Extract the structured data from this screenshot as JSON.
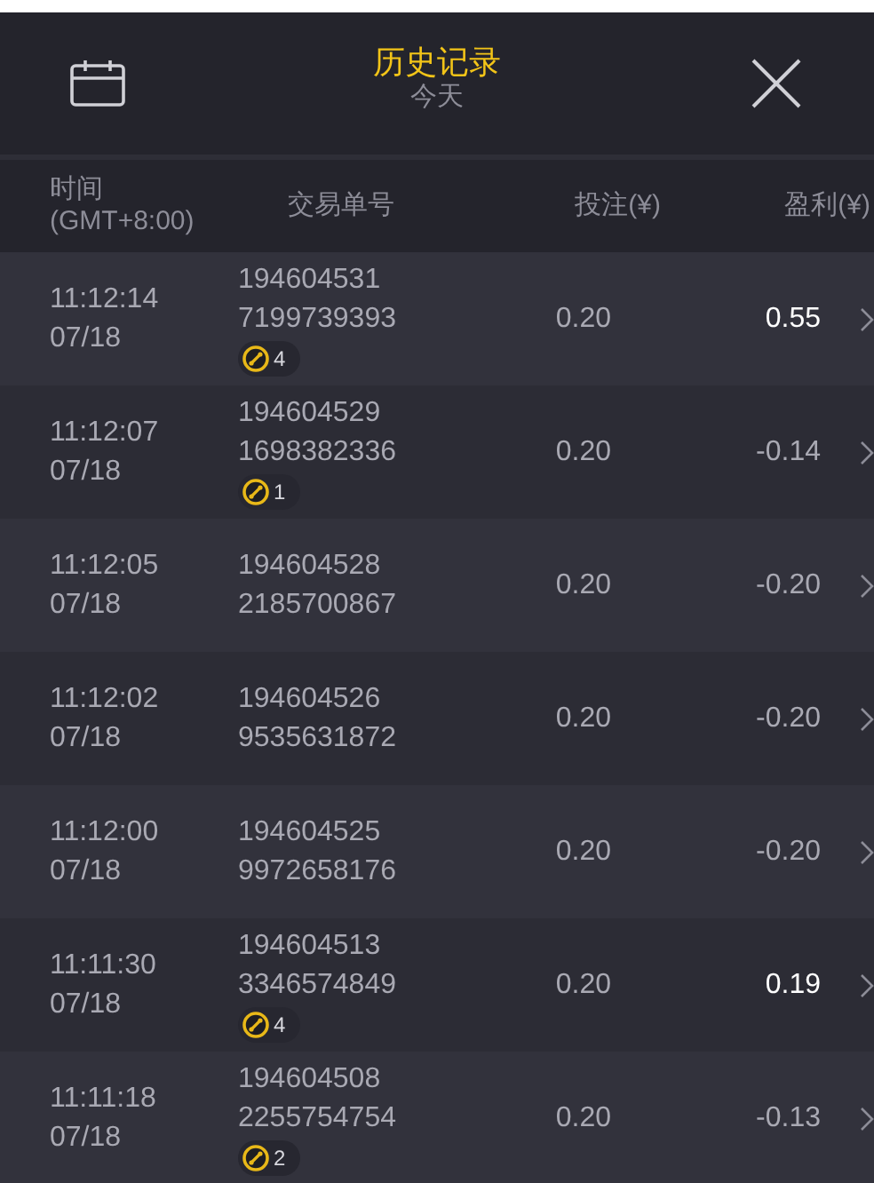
{
  "header": {
    "title": "历史记录",
    "subtitle": "今天"
  },
  "columns": [
    "时间\n(GMT+8:00)",
    "交易单号",
    "投注(¥)",
    "盈利(¥)"
  ],
  "rows": [
    {
      "time": "11:12:14",
      "date": "07/18",
      "id1": "194604531",
      "id2": "7199739393",
      "badge": "4",
      "bet": "0.20",
      "profit": "0.55",
      "win": true
    },
    {
      "time": "11:12:07",
      "date": "07/18",
      "id1": "194604529",
      "id2": "1698382336",
      "badge": "1",
      "bet": "0.20",
      "profit": "-0.14",
      "win": false
    },
    {
      "time": "11:12:05",
      "date": "07/18",
      "id1": "194604528",
      "id2": "2185700867",
      "bet": "0.20",
      "profit": "-0.20",
      "win": false
    },
    {
      "time": "11:12:02",
      "date": "07/18",
      "id1": "194604526",
      "id2": "9535631872",
      "bet": "0.20",
      "profit": "-0.20",
      "win": false
    },
    {
      "time": "11:12:00",
      "date": "07/18",
      "id1": "194604525",
      "id2": "9972658176",
      "bet": "0.20",
      "profit": "-0.20",
      "win": false
    },
    {
      "time": "11:11:30",
      "date": "07/18",
      "id1": "194604513",
      "id2": "3346574849",
      "badge": "4",
      "bet": "0.20",
      "profit": "0.19",
      "win": true
    },
    {
      "time": "11:11:18",
      "date": "07/18",
      "id1": "194604508",
      "id2": "2255754754",
      "badge": "2",
      "bet": "0.20",
      "profit": "-0.13",
      "win": false
    }
  ]
}
